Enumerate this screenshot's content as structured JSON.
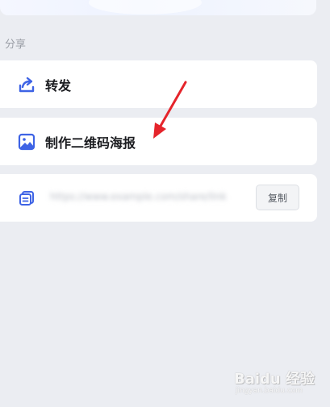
{
  "section": {
    "title": "分享"
  },
  "actions": [
    {
      "label": "转发",
      "icon": "share-forward-icon"
    },
    {
      "label": "制作二维码海报",
      "icon": "image-poster-icon"
    }
  ],
  "link_row": {
    "icon": "link-copy-icon",
    "url": "https://www.example.com/share/link",
    "copy_label": "复制"
  },
  "watermark": {
    "main": "Baidu 经验",
    "sub": "jingyan.baidu.com"
  },
  "colors": {
    "accent": "#3e63e5",
    "annotation_arrow": "#e5242b",
    "background": "#ebedf2"
  }
}
